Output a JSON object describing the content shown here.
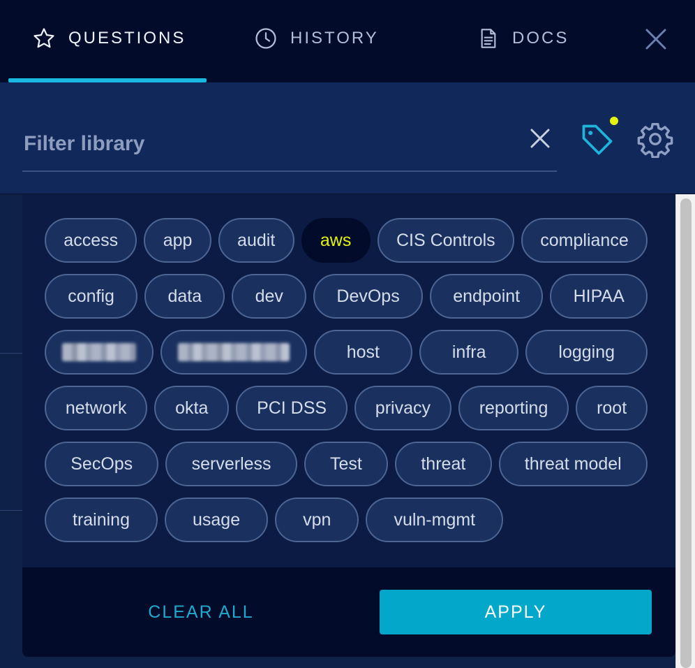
{
  "nav": {
    "tabs": [
      {
        "label": "QUESTIONS",
        "icon": "star-icon",
        "active": true
      },
      {
        "label": "HISTORY",
        "icon": "clock-icon",
        "active": false
      },
      {
        "label": "DOCS",
        "icon": "document-icon",
        "active": false
      }
    ],
    "close_icon": "close-icon"
  },
  "filter": {
    "placeholder": "Filter library",
    "value": "",
    "clear_icon": "close-icon",
    "tag_icon": "tag-icon",
    "settings_icon": "gear-icon",
    "tag_indicator_color": "#e4f20f"
  },
  "tags": {
    "rows": [
      [
        {
          "label": "access"
        },
        {
          "label": "app"
        },
        {
          "label": "audit"
        },
        {
          "label": "aws",
          "selected": true
        },
        {
          "label": "CIS Controls"
        },
        {
          "label": "compliance"
        }
      ],
      [
        {
          "label": "config"
        },
        {
          "label": "data"
        },
        {
          "label": "dev"
        },
        {
          "label": "DevOps"
        },
        {
          "label": "endpoint"
        },
        {
          "label": "HIPAA"
        }
      ],
      [
        {
          "label": "",
          "redacted": true
        },
        {
          "label": "",
          "redacted": true
        },
        {
          "label": "host"
        },
        {
          "label": "infra"
        },
        {
          "label": "logging"
        }
      ],
      [
        {
          "label": "network"
        },
        {
          "label": "okta"
        },
        {
          "label": "PCI DSS"
        },
        {
          "label": "privacy"
        },
        {
          "label": "reporting"
        },
        {
          "label": "root"
        }
      ],
      [
        {
          "label": "SecOps"
        },
        {
          "label": "serverless"
        },
        {
          "label": "Test"
        },
        {
          "label": "threat"
        },
        {
          "label": "threat model"
        }
      ],
      [
        {
          "label": "training"
        },
        {
          "label": "usage"
        },
        {
          "label": "vpn"
        },
        {
          "label": "vuln-mgmt"
        }
      ]
    ]
  },
  "actions": {
    "clear_all": "CLEAR ALL",
    "apply": "APPLY"
  },
  "colors": {
    "accent": "#19b8de",
    "apply_button": "#02a7c9",
    "selected_tag_text": "#e4f20f"
  }
}
